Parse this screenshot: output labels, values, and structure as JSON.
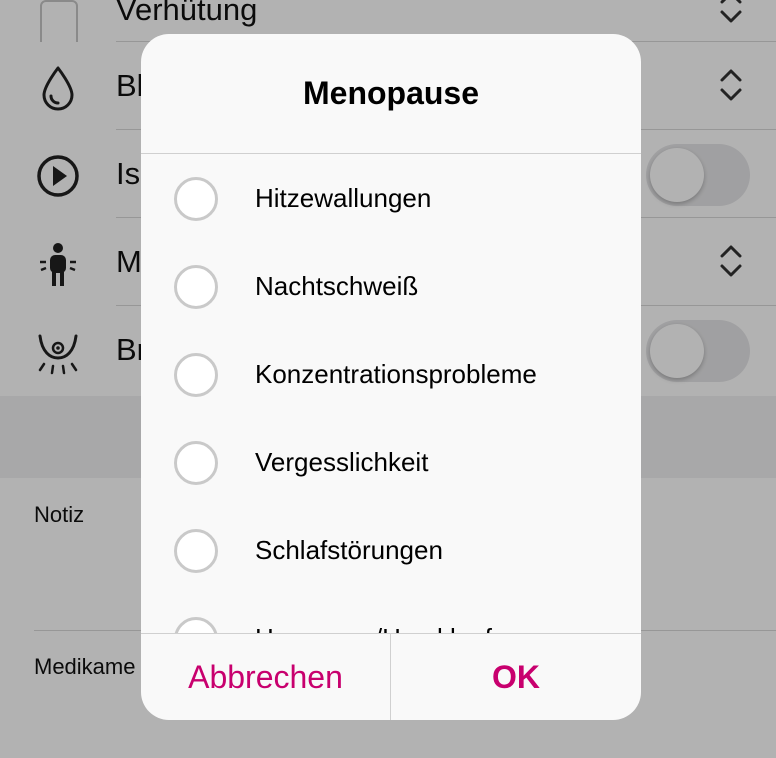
{
  "background": {
    "rows": [
      {
        "label": "Verhütung",
        "icon": "checkbox-icon",
        "control": "chevrons"
      },
      {
        "label": "Bl",
        "icon": "drop-icon",
        "control": "chevrons"
      },
      {
        "label": "Is",
        "icon": "play-circle-icon",
        "control": "toggle"
      },
      {
        "label": "M",
        "icon": "person-icon",
        "control": "chevrons"
      },
      {
        "label": "Br",
        "icon": "breast-icon",
        "control": "toggle"
      }
    ],
    "note_label": "Notiz",
    "medication_label": "Medikame"
  },
  "dialog": {
    "title": "Menopause",
    "options": [
      {
        "label": "Hitzewallungen",
        "selected": false
      },
      {
        "label": "Nachtschweiß",
        "selected": false
      },
      {
        "label": "Konzentrationsprobleme",
        "selected": false
      },
      {
        "label": "Vergesslichkeit",
        "selected": false
      },
      {
        "label": "Schlafstörungen",
        "selected": false
      },
      {
        "label": "Herzrasen/Herzklopfen",
        "selected": false
      }
    ],
    "cancel_label": "Abbrechen",
    "ok_label": "OK"
  },
  "colors": {
    "accent": "#c8006e",
    "overlay": "rgba(0,0,0,0.30)",
    "dialog_bg": "#f9f9f9"
  }
}
